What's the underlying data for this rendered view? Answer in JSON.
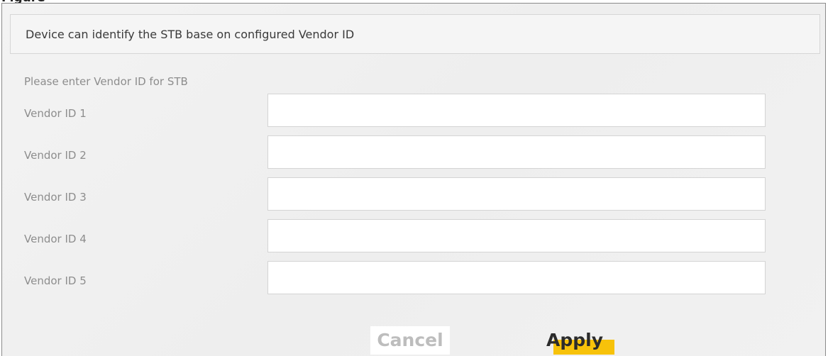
{
  "info": {
    "text": "Device can identify the STB base on configured Vendor ID"
  },
  "section": {
    "label": "Please enter Vendor ID for STB"
  },
  "vendor_ids": [
    {
      "label": "Vendor ID 1",
      "value": ""
    },
    {
      "label": "Vendor ID 2",
      "value": ""
    },
    {
      "label": "Vendor ID 3",
      "value": ""
    },
    {
      "label": "Vendor ID 4",
      "value": ""
    },
    {
      "label": "Vendor ID 5",
      "value": ""
    }
  ],
  "buttons": {
    "cancel_label": "Cancel",
    "apply_label": "Apply"
  },
  "colors": {
    "apply_accent": "#f7c20a",
    "label_gray": "#8d8d8d"
  }
}
